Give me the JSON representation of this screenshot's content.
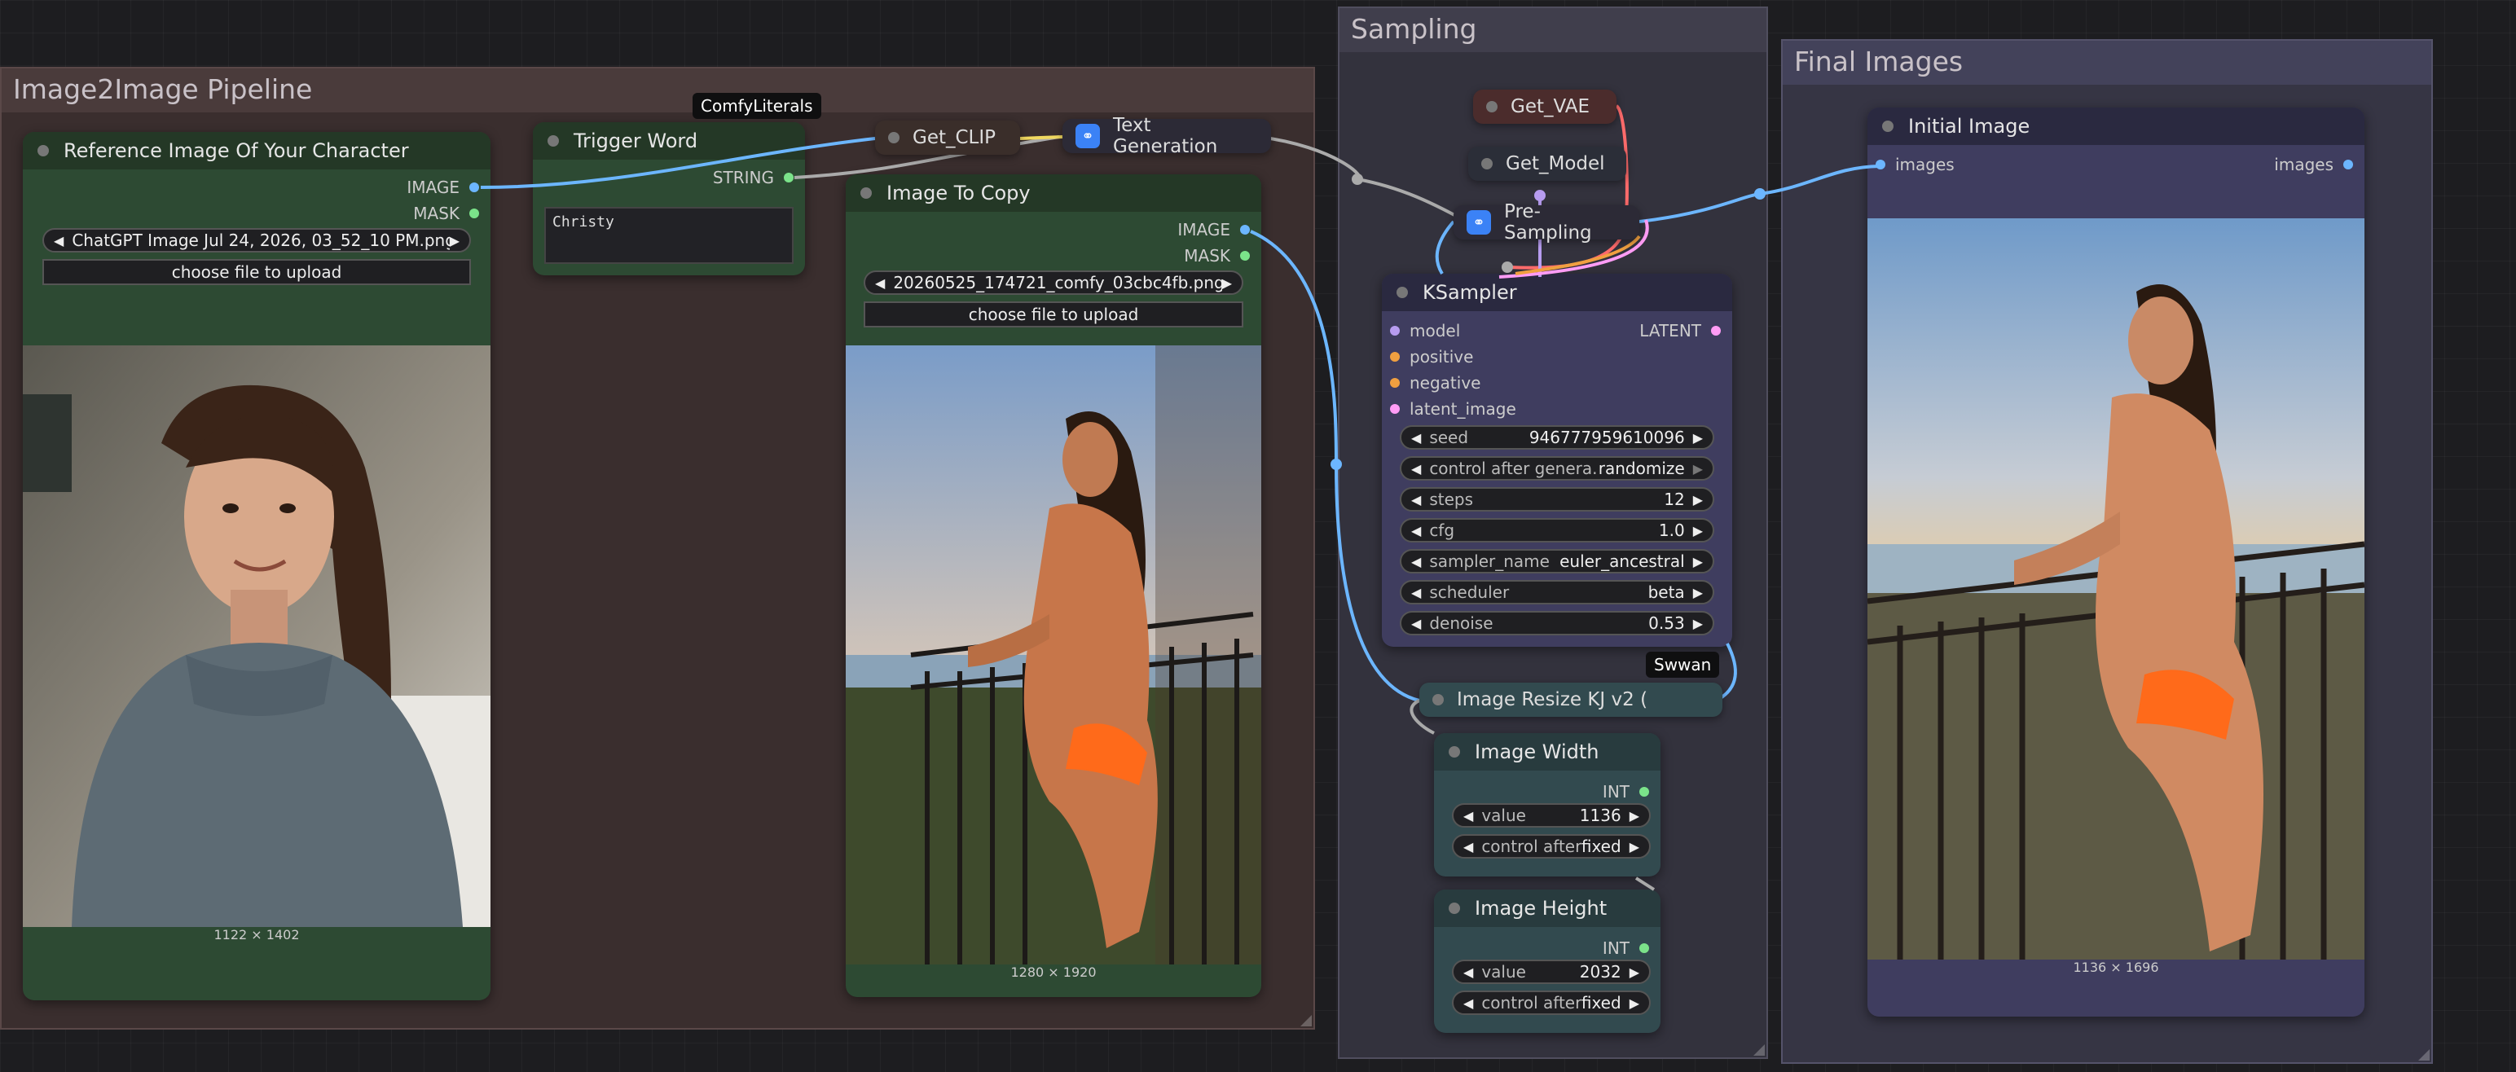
{
  "groups": {
    "pipeline": "Image2Image Pipeline",
    "sampling": "Sampling",
    "final": "Final Images"
  },
  "tooltips": {
    "comfy": "ComfyLiterals",
    "swwan": "Swwan"
  },
  "ref_node": {
    "title": "Reference Image Of Your Character",
    "out_image": "IMAGE",
    "out_mask": "MASK",
    "file": "ChatGPT Image Jul 24, 2026, 03_52_10 PM.png",
    "upload": "choose file to upload",
    "dims": "1122 × 1402"
  },
  "trigger_node": {
    "title": "Trigger Word",
    "out": "STRING",
    "text": "Christy"
  },
  "copy_node": {
    "title": "Image To Copy",
    "out_image": "IMAGE",
    "out_mask": "MASK",
    "file": "20260525_174721_comfy_03cbc4fb.png",
    "upload": "choose file to upload",
    "dims": "1280 × 1920"
  },
  "mini_nodes": {
    "get_clip": "Get_CLIP",
    "text_gen": "Text Generation",
    "get_vae": "Get_VAE",
    "get_model": "Get_Model",
    "pre_sampling": "Pre-Sampling"
  },
  "ksampler": {
    "title": "KSampler",
    "inputs": [
      "model",
      "positive",
      "negative",
      "latent_image"
    ],
    "output": "LATENT",
    "widgets": [
      {
        "label": "seed",
        "value": "946777959610096"
      },
      {
        "label": "control after genera...",
        "value": "randomize"
      },
      {
        "label": "steps",
        "value": "12"
      },
      {
        "label": "cfg",
        "value": "1.0"
      },
      {
        "label": "sampler_name",
        "value": "euler_ancestral"
      },
      {
        "label": "scheduler",
        "value": "beta"
      },
      {
        "label": "denoise",
        "value": "0.53"
      }
    ]
  },
  "resize_node": {
    "title": "Image Resize KJ v2 ("
  },
  "width_node": {
    "title": "Image Width",
    "out": "INT",
    "value_label": "value",
    "value": "1136",
    "control_label": "control after g...",
    "control_value": "fixed"
  },
  "height_node": {
    "title": "Image Height",
    "out": "INT",
    "value_label": "value",
    "value": "2032",
    "control_label": "control after g...",
    "control_value": "fixed"
  },
  "initial_node": {
    "title": "Initial Image",
    "in": "images",
    "out": "images",
    "dims": "1136 × 1696"
  },
  "colors": {
    "wire_image": "#6cb6ff",
    "wire_clip": "#f0d860",
    "wire_vae": "#ff6b6b",
    "wire_model": "#b79cf0",
    "wire_latent": "#ff9cf5",
    "wire_string": "#7be38a",
    "wire_grey": "#aaaaaa"
  }
}
